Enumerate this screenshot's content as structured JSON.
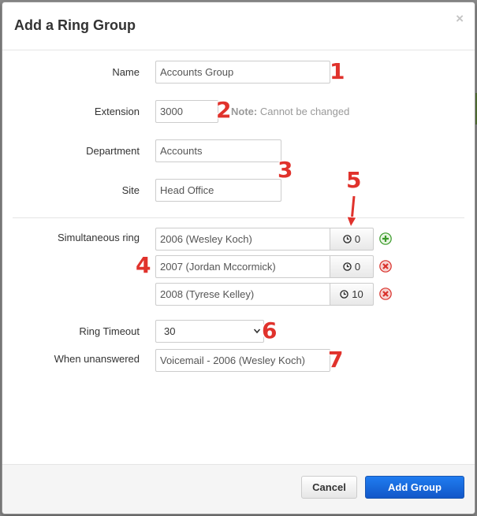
{
  "dialog": {
    "title": "Add a Ring Group",
    "close_symbol": "×"
  },
  "form": {
    "name_label": "Name",
    "name_value": "Accounts Group",
    "extension_label": "Extension",
    "extension_value": "3000",
    "extension_note_bold": "Note:",
    "extension_note": "Cannot be changed",
    "department_label": "Department",
    "department_value": "Accounts",
    "site_label": "Site",
    "site_value": "Head Office",
    "simultaneous_label": "Simultaneous ring",
    "ring_members": [
      {
        "member": "2006 (Wesley Koch)",
        "delay": "0",
        "action_icon": "add-icon"
      },
      {
        "member": "2007 (Jordan Mccormick)",
        "delay": "0",
        "action_icon": "remove-icon"
      },
      {
        "member": "2008 (Tyrese Kelley)",
        "delay": "10",
        "action_icon": "remove-icon"
      }
    ],
    "ring_timeout_label": "Ring Timeout",
    "ring_timeout_value": "30",
    "unanswered_label": "When unanswered",
    "unanswered_value": "Voicemail - 2006 (Wesley Koch)"
  },
  "annotations": [
    "1",
    "2",
    "3",
    "4",
    "5",
    "6",
    "7"
  ],
  "footer": {
    "cancel_label": "Cancel",
    "add_label": "Add Group"
  },
  "colors": {
    "primary": "#1f6fe0",
    "annotation": "#e0322c",
    "add_icon": "#3a9a2a",
    "remove_icon": "#d9302a"
  }
}
